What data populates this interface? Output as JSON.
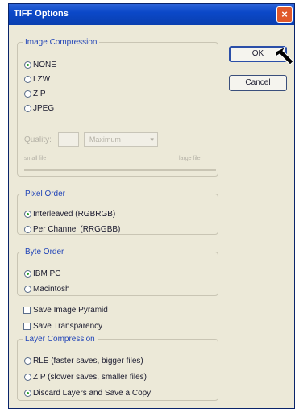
{
  "dialog": {
    "title": "TIFF Options",
    "close_glyph": "×"
  },
  "image_compression": {
    "legend": "Image Compression",
    "options": [
      "NONE",
      "LZW",
      "ZIP",
      "JPEG"
    ],
    "selected": "NONE",
    "quality_label": "Quality:",
    "quality_value": "Maximum",
    "small_file": "small file",
    "large_file": "large file"
  },
  "pixel_order": {
    "legend": "Pixel Order",
    "options": [
      "Interleaved (RGBRGB)",
      "Per Channel (RRGGBB)"
    ],
    "selected": "Interleaved (RGBRGB)"
  },
  "byte_order": {
    "legend": "Byte Order",
    "options": [
      "IBM PC",
      "Macintosh"
    ],
    "selected": "IBM PC"
  },
  "checkboxes": {
    "save_pyramid": "Save Image Pyramid",
    "save_transparency": "Save Transparency"
  },
  "layer_compression": {
    "legend": "Layer Compression",
    "options": [
      "RLE (faster saves, bigger files)",
      "ZIP (slower saves, smaller files)",
      "Discard Layers and Save a Copy"
    ],
    "selected": "Discard Layers and Save a Copy"
  },
  "buttons": {
    "ok": "OK",
    "cancel": "Cancel"
  },
  "icons": {
    "close": "close-icon",
    "cursor": "arrow-cursor-icon"
  },
  "colors": {
    "title_bar": "#0b48c8",
    "dialog_bg": "#ece9d8",
    "legend_text": "#2346b8",
    "close_button": "#e0582a"
  }
}
